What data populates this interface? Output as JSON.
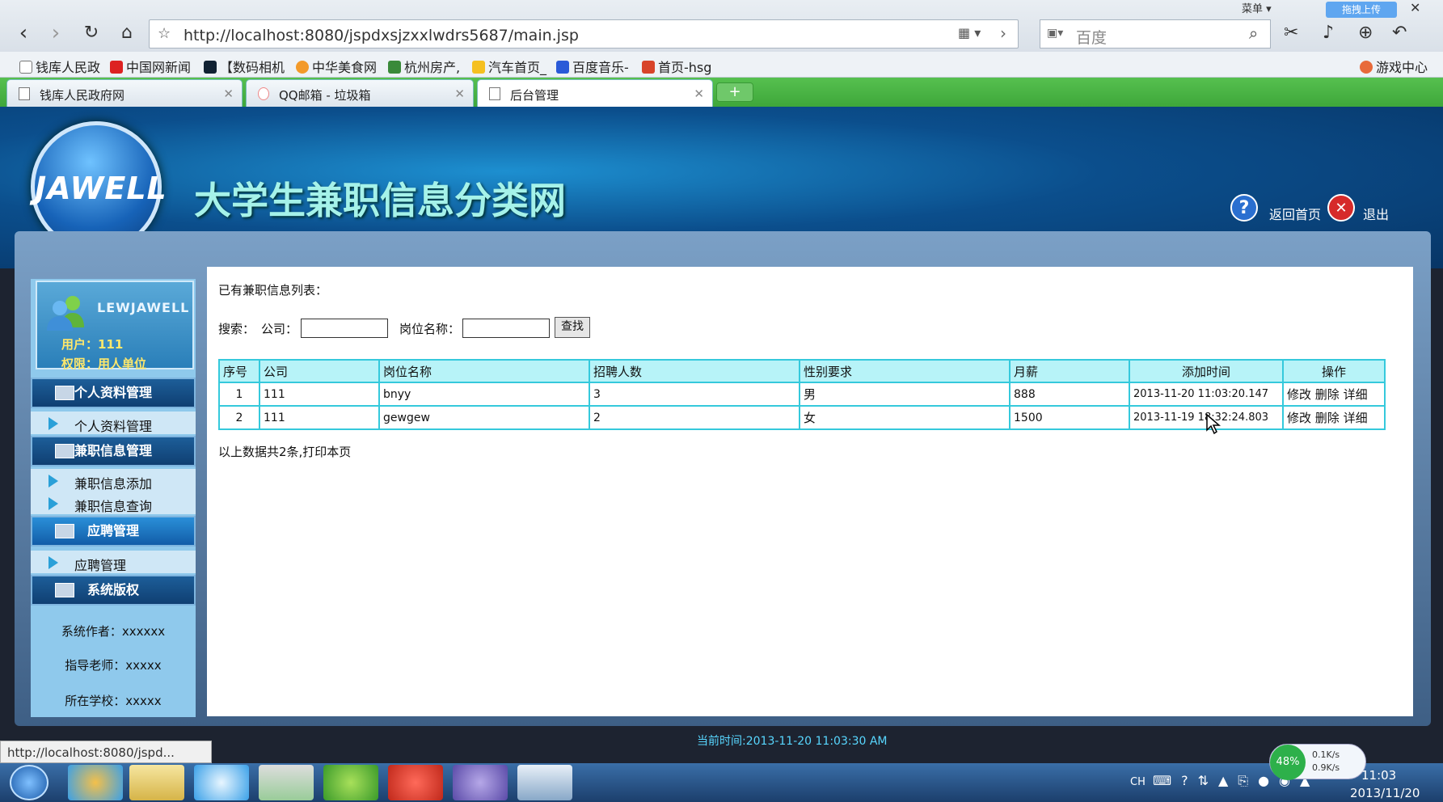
{
  "browser": {
    "top_row_label": "菜单",
    "upload_label": "拖拽上传",
    "url": "http://localhost:8080/jspdxsjzxxlwdrs5687/main.jsp",
    "search_placeholder": "百度",
    "bookmarks": [
      "钱库人民政",
      "中国网新闻",
      "【数码相机",
      "中华美食网",
      "杭州房产,",
      "汽车首页_",
      "百度音乐-",
      "首页-hsg"
    ],
    "bookmark_right": "游戏中心",
    "tabs": [
      {
        "title": "钱库人民政府网"
      },
      {
        "title": "QQ邮箱 - 垃圾箱"
      },
      {
        "title": "后台管理"
      }
    ],
    "new_tab": "+",
    "status_url": "http://localhost:8080/jspd..."
  },
  "header": {
    "logo_text": "JAWELL",
    "site_title": "大学生兼职信息分类网",
    "help_icon_glyph": "?",
    "close_icon_glyph": "✕",
    "home_link": "返回首页",
    "logout_link": "退出"
  },
  "sidebar": {
    "username": "LEWJAWELL",
    "user_label": "用户：111",
    "role_label": "权限：用人单位",
    "sections": [
      {
        "title": "个人资料管理",
        "items": [
          "个人资料管理"
        ]
      },
      {
        "title": "兼职信息管理",
        "items": [
          "兼职信息添加",
          "兼职信息查询"
        ]
      },
      {
        "title": "应聘管理",
        "items": [
          "应聘管理"
        ]
      },
      {
        "title": "系统版权",
        "items": []
      }
    ],
    "author": "系统作者：xxxxxx",
    "teacher": "指导老师：xxxxx",
    "school": "所在学校：xxxxx"
  },
  "main": {
    "list_title": "已有兼职信息列表：",
    "search_label": "搜索：",
    "company_label": "公司：",
    "position_label": "岗位名称：",
    "company_value": "",
    "position_value": "",
    "find_button": "查找",
    "columns": [
      "序号",
      "公司",
      "岗位名称",
      "招聘人数",
      "性别要求",
      "月薪",
      "添加时间",
      "操作"
    ],
    "rows": [
      {
        "no": "1",
        "company": "111",
        "position": "bnyy",
        "count": "3",
        "gender": "男",
        "salary": "888",
        "time": "2013-11-20 11:03:20.147"
      },
      {
        "no": "2",
        "company": "111",
        "position": "gewgew",
        "count": "2",
        "gender": "女",
        "salary": "1500",
        "time": "2013-11-19 18:32:24.803"
      }
    ],
    "actions": {
      "edit": "修改",
      "delete": "删除",
      "detail": "详细"
    },
    "summary": "以上数据共2条,打印本页"
  },
  "footer": {
    "current_time": "当前时间:2013-11-20 11:03:30 AM"
  },
  "taskbar": {
    "lang": "CH",
    "clock_time": "11:03",
    "clock_date": "2013/11/20",
    "net_percent": "48%",
    "net_up": "0.1K/s",
    "net_down": "0.9K/s"
  }
}
